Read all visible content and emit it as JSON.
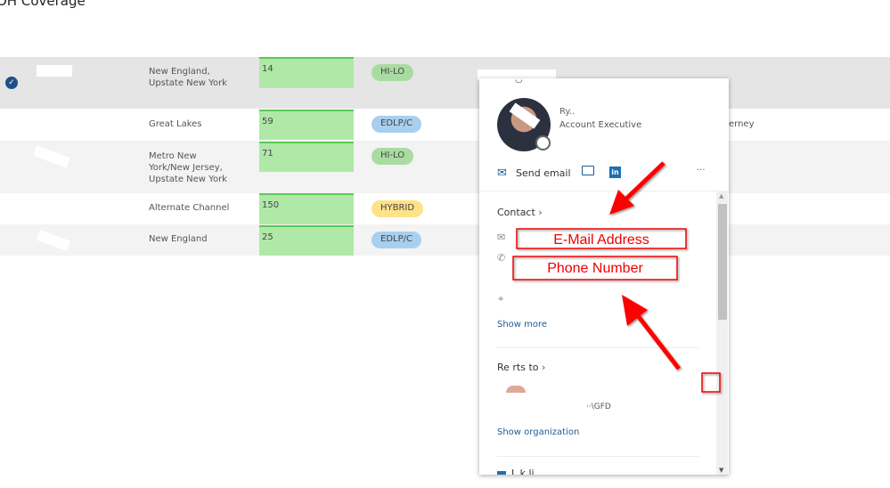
{
  "page_title": "OH Coverage",
  "rows": [
    {
      "region": "New England, Upstate New York",
      "qty": "14",
      "type": "HI-LO",
      "type_color": "#a8dca0",
      "selected": true
    },
    {
      "region": "Great Lakes",
      "qty": "59",
      "type": "EDLP/C",
      "type_color": "#a9cfee",
      "selected": false
    },
    {
      "region": "Metro New York/New Jersey, Upstate New York",
      "qty": "71",
      "type": "HI-LO",
      "type_color": "#a8dca0",
      "selected": false
    },
    {
      "region": "Alternate Channel",
      "qty": "150",
      "type": "HYBRID",
      "type_color": "#fde28a",
      "selected": false
    },
    {
      "region": "New England",
      "qty": "25",
      "type": "EDLP/C",
      "type_color": "#a9cfee",
      "selected": false
    }
  ],
  "right_partial_text": "erney",
  "card": {
    "name": "Ry..",
    "job_title": "Account Executive",
    "send_email": "Send email",
    "more": "···",
    "contact_heading": "Contact",
    "show_more": "Show more",
    "reports_to_heading": "Re  rts to",
    "manager_partial": "··\\GFD",
    "show_organization": "Show organization",
    "next_section": "L k  li"
  },
  "annotations": {
    "email": "E-Mail Address",
    "phone": "Phone Number"
  },
  "colors": {
    "accent": "#1f5c99",
    "annotation": "#ff0000",
    "qty_fill": "#b0e8a8"
  }
}
